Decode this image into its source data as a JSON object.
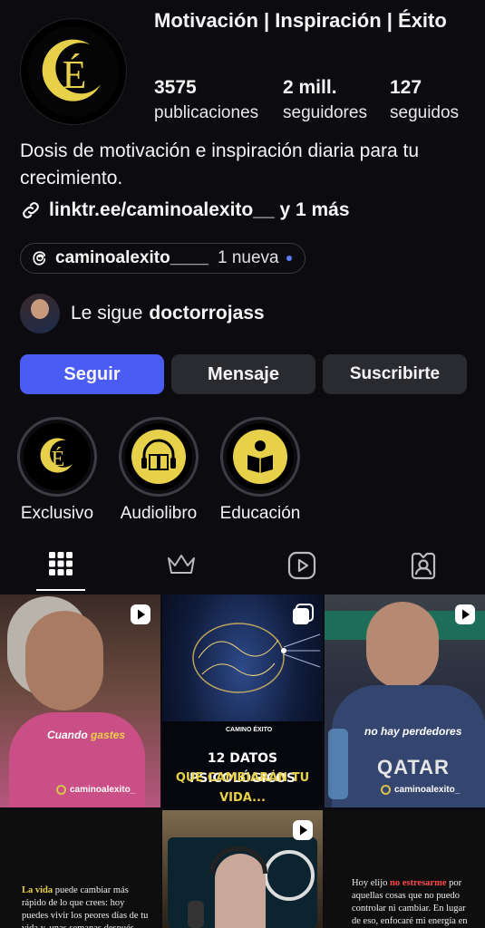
{
  "profile": {
    "name": "Motivación | Inspiración | Éxito",
    "avatar_letter": "É",
    "stats": [
      {
        "value": "3575",
        "label": "publicaciones"
      },
      {
        "value": "2 mill.",
        "label": "seguidores"
      },
      {
        "value": "127",
        "label": "seguidos"
      }
    ],
    "bio": "Dosis de motivación e inspiración diaria para tu crecimiento.",
    "link": "linktr.ee/caminoalexito__ y 1 más",
    "threads": {
      "handle": "caminoalexito____",
      "new_label": "1 nueva"
    },
    "followed_by": {
      "prefix": "Le sigue",
      "user": "doctorrojass"
    }
  },
  "buttons": {
    "follow": "Seguir",
    "message": "Mensaje",
    "subscribe": "Suscribirte"
  },
  "highlights": [
    {
      "label": "Exclusivo",
      "icon": "logo-e-icon"
    },
    {
      "label": "Audiolibro",
      "icon": "headphones-book-icon"
    },
    {
      "label": "Educación",
      "icon": "reading-person-icon"
    }
  ],
  "tabs": [
    {
      "icon": "grid-icon"
    },
    {
      "icon": "crown-icon"
    },
    {
      "icon": "reels-icon"
    },
    {
      "icon": "tagged-icon"
    }
  ],
  "posts": {
    "p1": {
      "caption_white": "Cuando",
      "caption_yellow": "gastes",
      "brand": "caminoalexito_"
    },
    "p2": {
      "brand_top": "CAMINO ÉXITO",
      "title_line1": "12 DATOS PSICOLÓGICOS",
      "title_line2": "QUE CAMBIARÁN TU VIDA..."
    },
    "p3": {
      "caption": "no hay perdedores",
      "brand": "caminoalexito_",
      "shirt_text": "QATAR"
    },
    "p4": {
      "text_bold": "La vida",
      "text_rest": "puede cambiar más rápido de lo que crees: hoy puedes vivir los peores días de tu vida y, unas semanas después, experimentar el"
    },
    "p6": {
      "text_a": "Hoy elijo",
      "text_bold": "no estresarme",
      "text_b": "por aquellas cosas que no puedo controlar ni cambiar. En lugar de eso, enfocaré mi energía en crear paz en mi vida"
    }
  },
  "colors": {
    "accent": "#4b5cf5",
    "gold": "#e8d14a",
    "background": "#0c0c10",
    "button": "#2a2b31"
  }
}
